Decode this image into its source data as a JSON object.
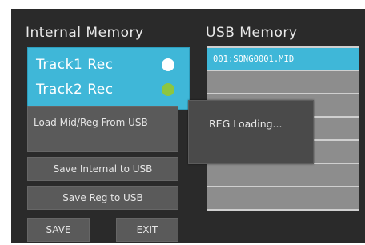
{
  "internal_memory": {
    "title": "Internal Memory",
    "tracks": [
      {
        "label": "Track1 Rec",
        "indicator_color": "#ffffff"
      },
      {
        "label": "Track2 Rec",
        "indicator_color": "#8dc63f"
      }
    ]
  },
  "usb_memory": {
    "title": "USB Memory",
    "files": [
      {
        "name": "001:SONG0001.MID",
        "selected": true
      },
      {
        "name": ""
      },
      {
        "name": ""
      },
      {
        "name": ""
      },
      {
        "name": ""
      },
      {
        "name": ""
      },
      {
        "name": ""
      }
    ]
  },
  "buttons": {
    "load": "Load Mid/Reg From USB",
    "save_internal": "Save Internal to USB",
    "save_reg": "Save Reg to USB",
    "save": "SAVE",
    "exit": "EXIT"
  },
  "popup": {
    "message": "REG Loading..."
  },
  "colors": {
    "accent": "#3fb7d8",
    "background": "#2a2a2a",
    "button": "#5a5a5a",
    "file_row": "#8d8d8d"
  }
}
